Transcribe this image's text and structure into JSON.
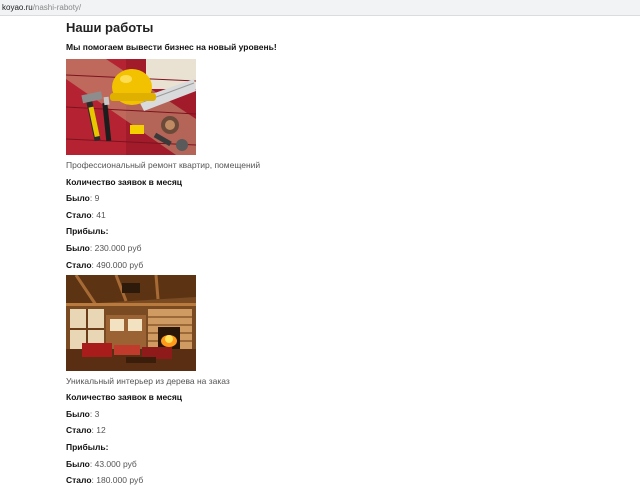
{
  "browser": {
    "url_host": "koyao.ru",
    "url_path": "/nashi-raboty/"
  },
  "page": {
    "title": "Наши работы",
    "subtitle": "Мы помогаем вывести бизнес на новый уровень!"
  },
  "cards": [
    {
      "image_icon": "tools-photo",
      "caption": "Профессиональный ремонт квартир, помещений",
      "requests_heading": "Количество заявок в месяц",
      "before_label": "Было",
      "before_requests": "9",
      "after_label": "Стало",
      "after_requests": "41",
      "profit_heading": "Прибыль:",
      "before_profit": "230.000 руб",
      "after_profit": "490.000 руб"
    },
    {
      "image_icon": "wooden-interior-photo",
      "caption": "Уникальный интерьер из дерева на заказ",
      "requests_heading": "Количество заявок в месяц",
      "before_label": "Было",
      "before_requests": "3",
      "after_label": "Стало",
      "after_requests": "12",
      "profit_heading": "Прибыль:",
      "before_profit": "43.000 руб",
      "after_profit": "180.000 руб"
    }
  ]
}
